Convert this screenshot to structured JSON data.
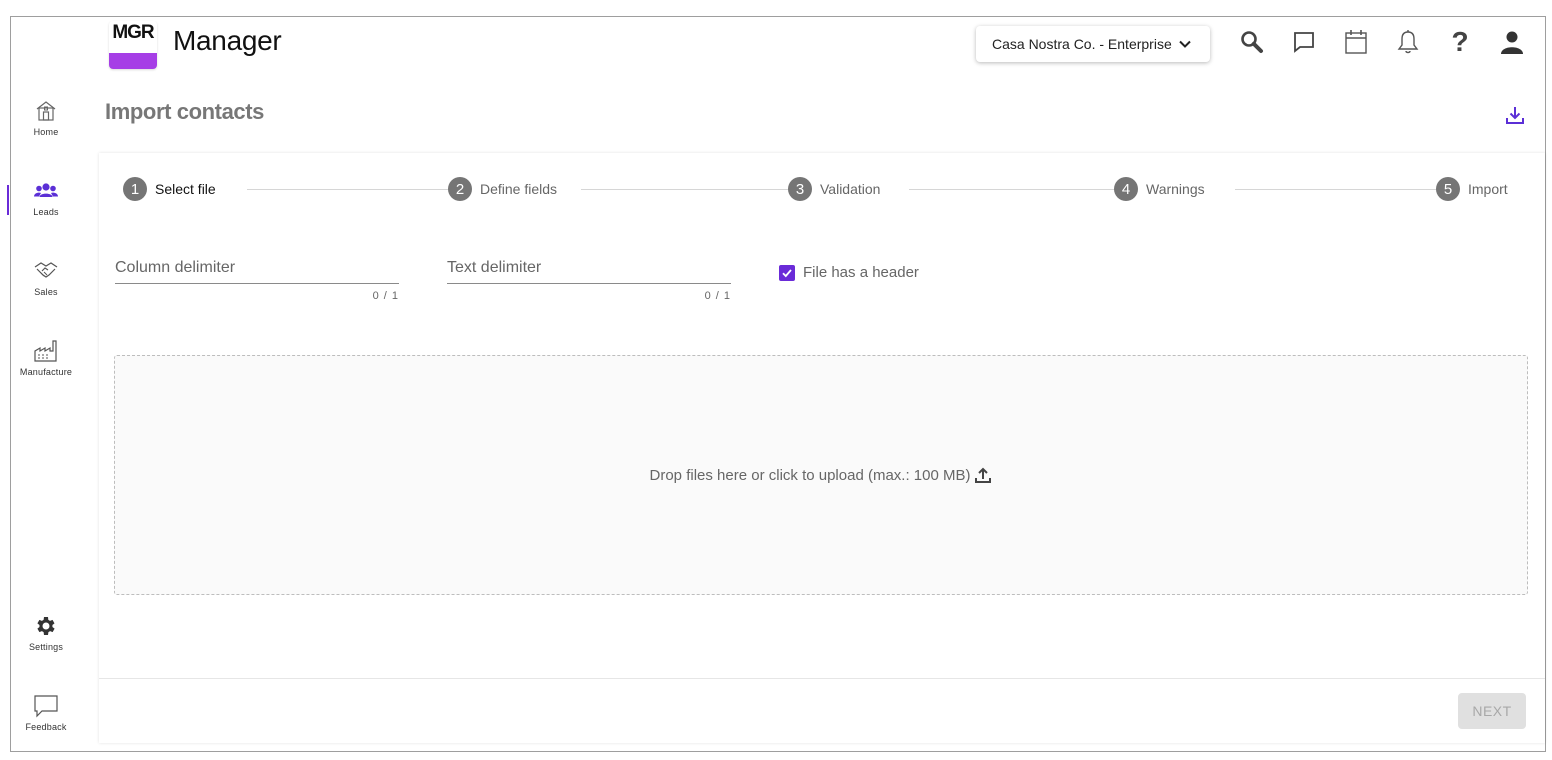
{
  "app": {
    "logo_text": "MGR",
    "name": "Manager"
  },
  "header": {
    "company": "Casa Nostra Co. - Enterprise",
    "icons": [
      "search-icon",
      "chat-icon",
      "calendar-icon",
      "bell-icon",
      "help-icon",
      "account-icon"
    ],
    "help_glyph": "?"
  },
  "sidebar": {
    "items": [
      {
        "label": "Home",
        "icon": "home-icon"
      },
      {
        "label": "Leads",
        "icon": "people-icon",
        "active": true
      },
      {
        "label": "Sales",
        "icon": "handshake-icon"
      },
      {
        "label": "Manufacture",
        "icon": "factory-icon"
      },
      {
        "label": "Settings",
        "icon": "gear-icon"
      },
      {
        "label": "Feedback",
        "icon": "feedback-icon"
      }
    ]
  },
  "page": {
    "title": "Import contacts"
  },
  "stepper": {
    "steps": [
      {
        "num": "1",
        "label": "Select file",
        "active": true
      },
      {
        "num": "2",
        "label": "Define fields"
      },
      {
        "num": "3",
        "label": "Validation"
      },
      {
        "num": "4",
        "label": "Warnings"
      },
      {
        "num": "5",
        "label": "Import"
      }
    ]
  },
  "form": {
    "column_delimiter": {
      "placeholder": "Column delimiter",
      "value": "",
      "counter": "0 / 1"
    },
    "text_delimiter": {
      "placeholder": "Text delimiter",
      "value": "",
      "counter": "0 / 1"
    },
    "header_checkbox": {
      "label": "File has a header",
      "checked": true
    }
  },
  "dropzone": {
    "text": "Drop files here or click to upload (max.: 100 MB)"
  },
  "footer": {
    "next_label": "NEXT",
    "next_disabled": true
  },
  "colors": {
    "accent": "#6a2bd8",
    "logo_band": "#a63ee6",
    "step_circle": "#757575"
  }
}
